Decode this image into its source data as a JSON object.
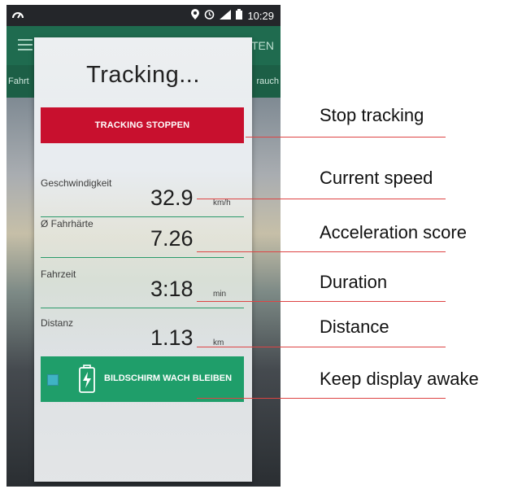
{
  "statusbar": {
    "time": "10:29"
  },
  "appbar": {
    "right_text": "TEN"
  },
  "tabs": {
    "left": "Fahrt",
    "right": "rauch"
  },
  "dialog": {
    "title": "Tracking...",
    "stop_button": "TRACKING STOPPEN",
    "rows": [
      {
        "label": "Geschwindigkeit",
        "value": "32.9",
        "unit": "km/h"
      },
      {
        "label": "Ø Fahrhärte",
        "value": "7.26",
        "unit": ""
      },
      {
        "label": "Fahrzeit",
        "value": "3:18",
        "unit": "min"
      },
      {
        "label": "Distanz",
        "value": "1.13",
        "unit": "km"
      }
    ],
    "awake_button": "BILDSCHIRM WACH BLEIBEN"
  },
  "annotations": {
    "stop": "Stop tracking",
    "speed": "Current speed",
    "accel": "Acceleration score",
    "duration": "Duration",
    "distance": "Distance",
    "awake": "Keep display awake"
  },
  "colors": {
    "stop_button": "#c8102e",
    "awake_button": "#1f9e6a",
    "appbar": "#1f6b4f",
    "annotation_line": "#dd4444"
  },
  "icons": [
    "speedometer-icon",
    "location-icon",
    "alarm-icon",
    "signal-icon",
    "battery-icon",
    "menu-icon",
    "battery-charging-icon"
  ]
}
